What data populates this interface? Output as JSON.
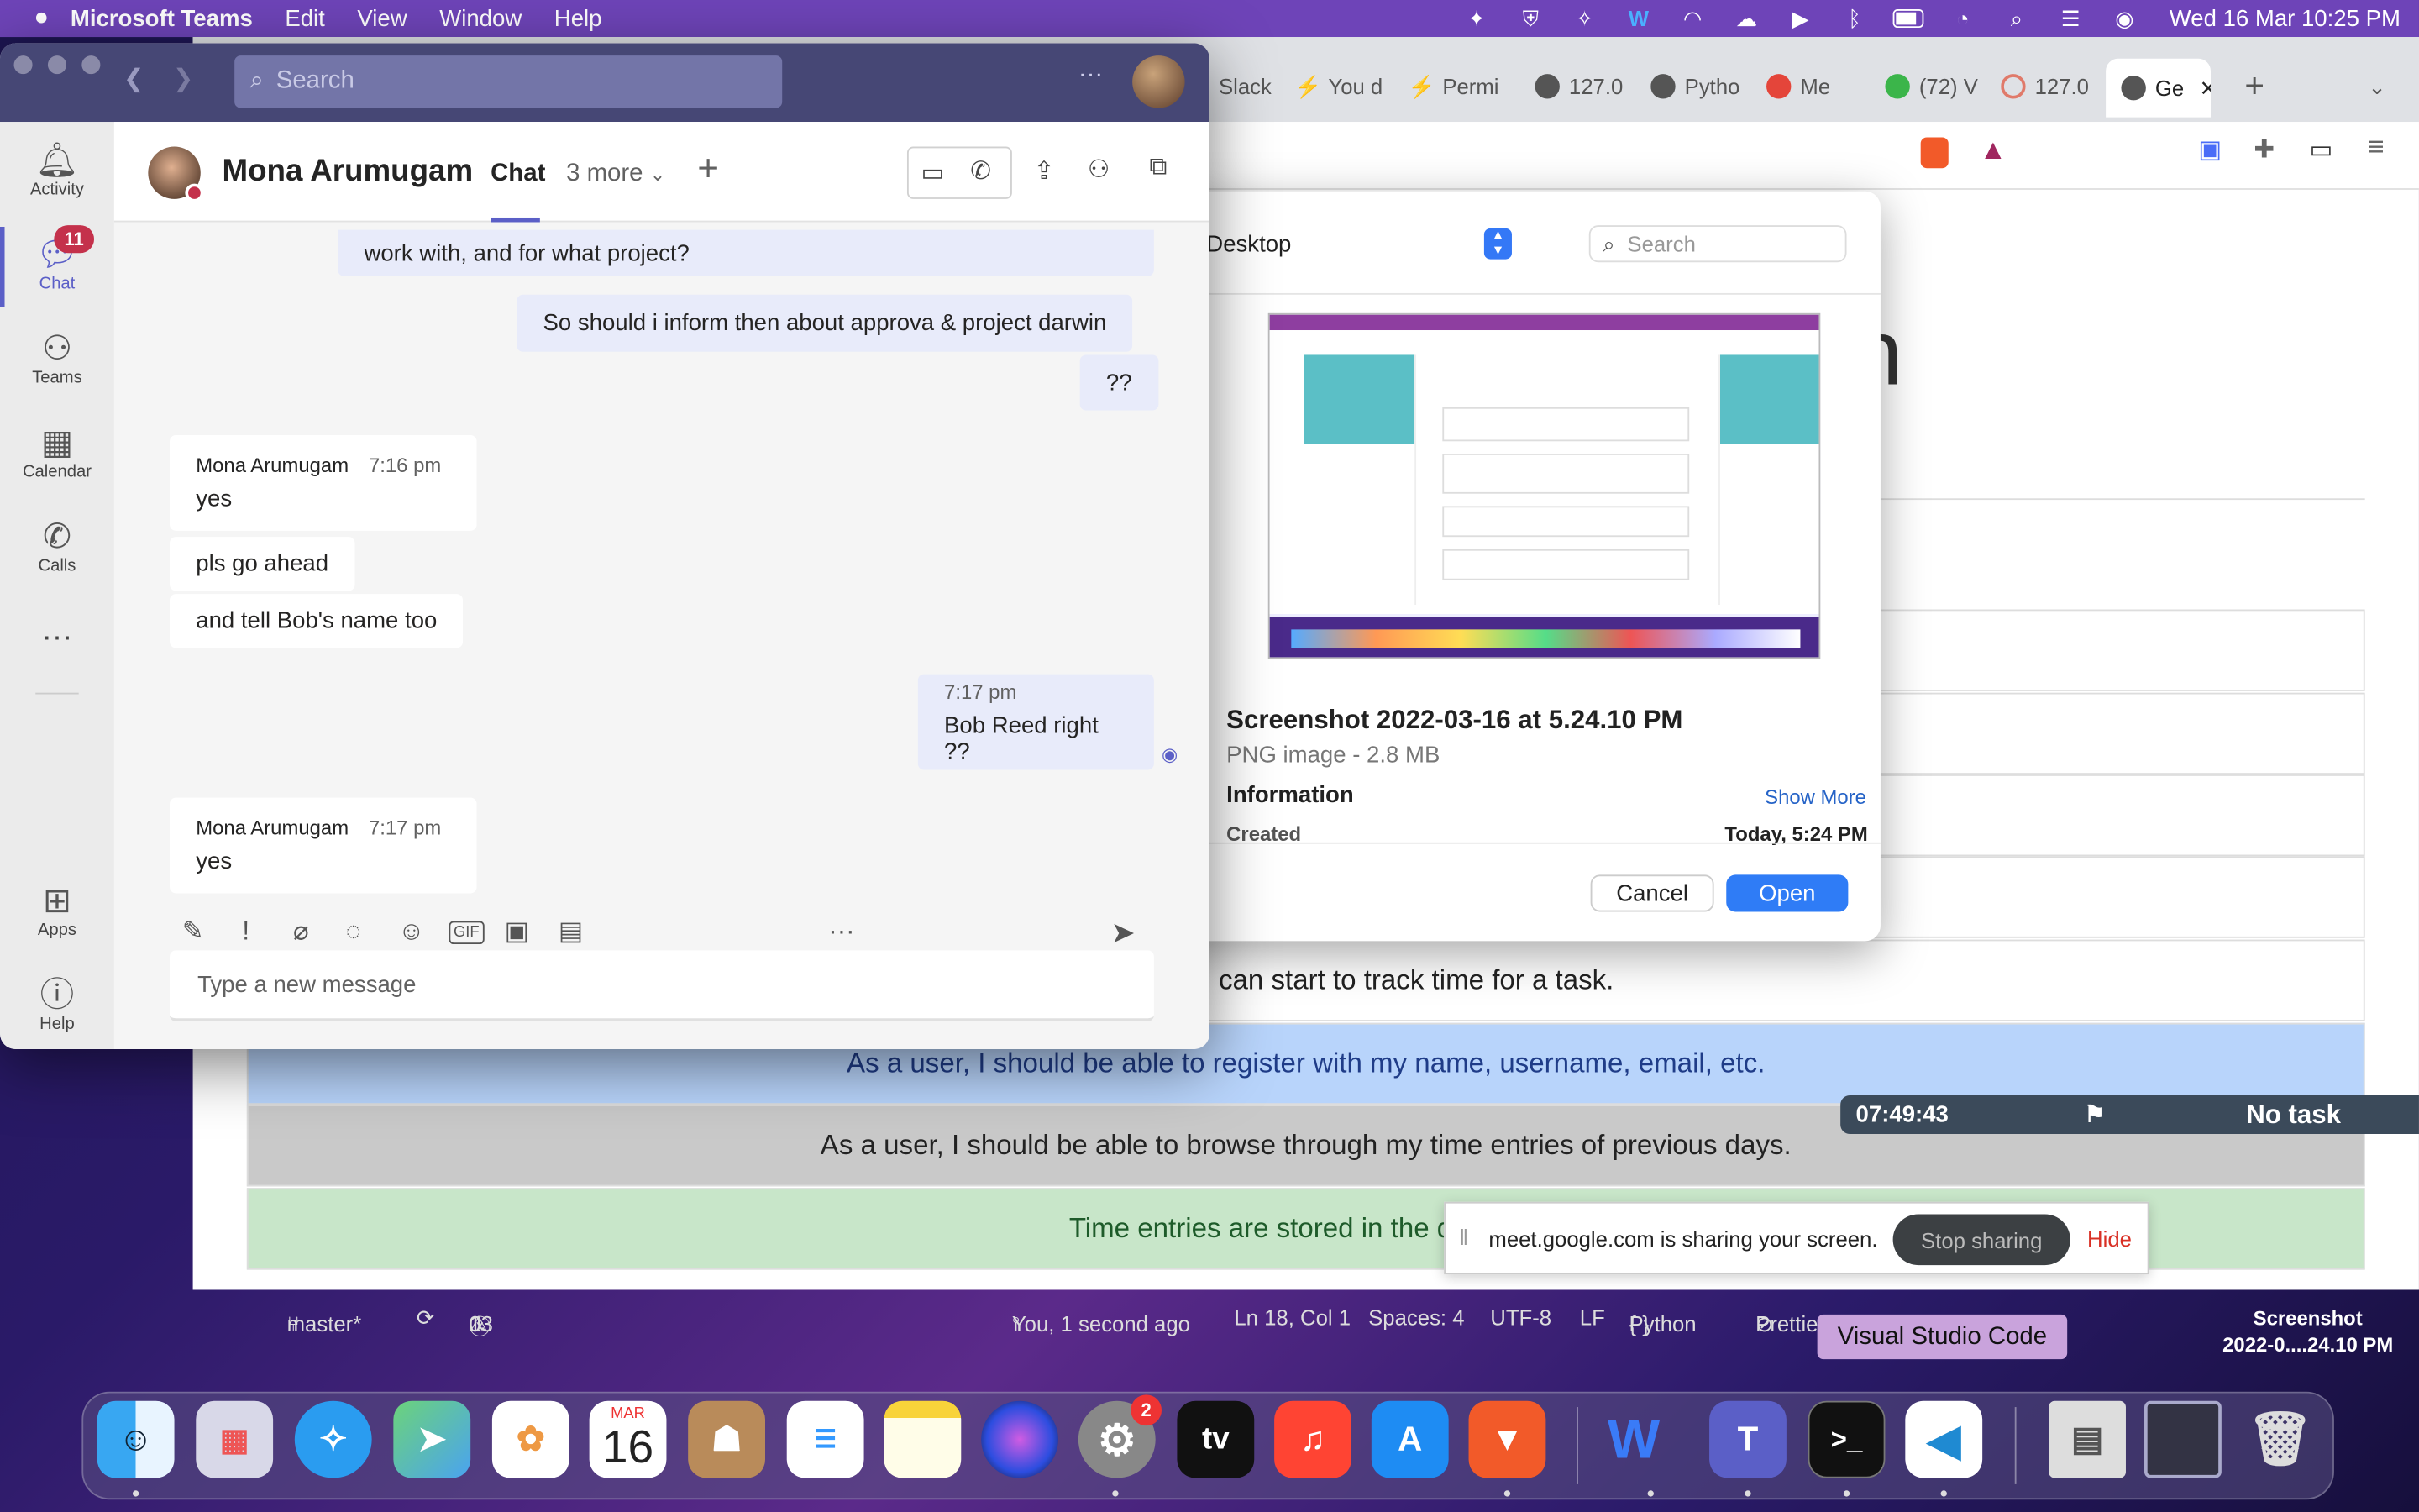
{
  "menubar": {
    "app": "Microsoft Teams",
    "items": [
      "Edit",
      "View",
      "Window",
      "Help"
    ],
    "clock": "Wed 16 Mar  10:25 PM"
  },
  "browser": {
    "tabs": [
      "Slack",
      "You d",
      "Permi",
      "127.0",
      "Pytho",
      "Me",
      "(72) V",
      "127.0",
      "Ge"
    ],
    "rows": [
      "can start to track time for a task.",
      "As a user, I should be able to register with my name, username, email, etc.",
      "As a user, I should be able to browse through my time entries of previous days.",
      "Time entries are stored in the d"
    ],
    "row_colors": [
      "#ffffff",
      "#b8d4fb",
      "#c9c9c9",
      "#c8e6c9"
    ],
    "timer": {
      "time": "07:49:43",
      "task": "No task"
    },
    "share": {
      "text": "meet.google.com is sharing your screen.",
      "stop": "Stop sharing",
      "hide": "Hide"
    }
  },
  "dialog": {
    "location": "Desktop",
    "search_placeholder": "Search",
    "file_name": "Screenshot 2022-03-16 at 5.24.10 PM",
    "file_type": "PNG image - 2.8 MB",
    "info_label": "Information",
    "show_more": "Show More",
    "created_label": "Created",
    "created_value": "Today, 5:24 PM",
    "cancel": "Cancel",
    "open": "Open"
  },
  "teams": {
    "search_placeholder": "Search",
    "rail": [
      {
        "label": "Activity",
        "icon": "bell-icon"
      },
      {
        "label": "Chat",
        "icon": "chat-icon",
        "badge": "11"
      },
      {
        "label": "Teams",
        "icon": "teams-icon"
      },
      {
        "label": "Calendar",
        "icon": "calendar-icon"
      },
      {
        "label": "Calls",
        "icon": "phone-icon"
      },
      {
        "label": "Apps",
        "icon": "apps-icon"
      },
      {
        "label": "Help",
        "icon": "help-icon"
      }
    ],
    "contact": "Mona Arumugam",
    "tab_chat": "Chat",
    "tab_more": "3 more",
    "messages": [
      {
        "text": "work with, and for what project?"
      },
      {
        "text": "So should i inform then about approva & project darwin"
      },
      {
        "text": "??"
      },
      {
        "sender": "Mona Arumugam",
        "time": "7:16 pm",
        "text": "yes"
      },
      {
        "text": "pls go ahead"
      },
      {
        "text": "and tell Bob's name too"
      },
      {
        "time": "7:17 pm",
        "text": "Bob Reed right ??"
      },
      {
        "sender": "Mona Arumugam",
        "time": "7:17 pm",
        "text": "yes"
      }
    ],
    "compose_placeholder": "Type a new message"
  },
  "vscode_status": {
    "branch": "master*",
    "problems": "0",
    "warnings": "13",
    "blame": "You, 1 second ago",
    "position": "Ln 18, Col 1",
    "spaces": "Spaces: 4",
    "encoding": "UTF-8",
    "eol": "LF",
    "language": "Python",
    "prettier": "Prettier"
  },
  "tooltip": "Visual Studio Code",
  "desktop_file": {
    "label1": "Screenshot",
    "label2": "2022-0....24.10 PM"
  },
  "dock": {
    "calendar_month": "MAR",
    "calendar_day": "16",
    "settings_badge": "2",
    "tv_label": "tv"
  }
}
